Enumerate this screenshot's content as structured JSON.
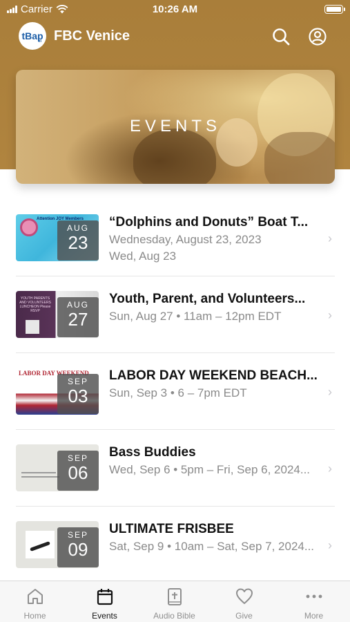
{
  "status_bar": {
    "carrier": "Carrier",
    "time": "10:26 AM"
  },
  "header": {
    "logo_text": "tBap",
    "logo_sub": "vi",
    "title": "FBC Venice",
    "search_icon": "search-icon",
    "profile_icon": "account-icon"
  },
  "banner": {
    "title": "EVENTS"
  },
  "events": [
    {
      "title": "“Dolphins and Donuts” Boat T...",
      "month": "AUG",
      "day": "23",
      "line1": "Wednesday, August 23, 2023",
      "line2": "Wed, Aug 23",
      "thumb_text": "Attention JOY Members"
    },
    {
      "title": "Youth, Parent, and Volunteers...",
      "month": "AUG",
      "day": "27",
      "line1": "Sun, Aug 27 • 11am – 12pm EDT",
      "line2": "",
      "thumb_text": "YOUTH PARENTS AND VOLUNTEERS LUNCHEON Please RSVP"
    },
    {
      "title": "LABOR DAY WEEKEND BEACH...",
      "month": "SEP",
      "day": "03",
      "line1": "Sun, Sep 3 • 6 – 7pm EDT",
      "line2": "",
      "thumb_text": "LABOR DAY WEEKEND"
    },
    {
      "title": "Bass Buddies",
      "month": "SEP",
      "day": "06",
      "line1": "Wed, Sep 6 • 5pm – Fri, Sep 6, 2024...",
      "line2": "",
      "thumb_text": ""
    },
    {
      "title": "ULTIMATE FRISBEE",
      "month": "SEP",
      "day": "09",
      "line1": "Sat, Sep 9 • 10am – Sat, Sep 7, 2024...",
      "line2": "",
      "thumb_text": ""
    }
  ],
  "tabs": [
    {
      "label": "Home",
      "icon": "home-icon",
      "active": false
    },
    {
      "label": "Events",
      "icon": "calendar-icon",
      "active": true
    },
    {
      "label": "Audio Bible",
      "icon": "bible-icon",
      "active": false
    },
    {
      "label": "Give",
      "icon": "heart-icon",
      "active": false
    },
    {
      "label": "More",
      "icon": "more-icon",
      "active": false
    }
  ],
  "colors": {
    "header_brown": "#a97e3a",
    "text_dark": "#111111",
    "text_gray": "#8a8a8a"
  }
}
